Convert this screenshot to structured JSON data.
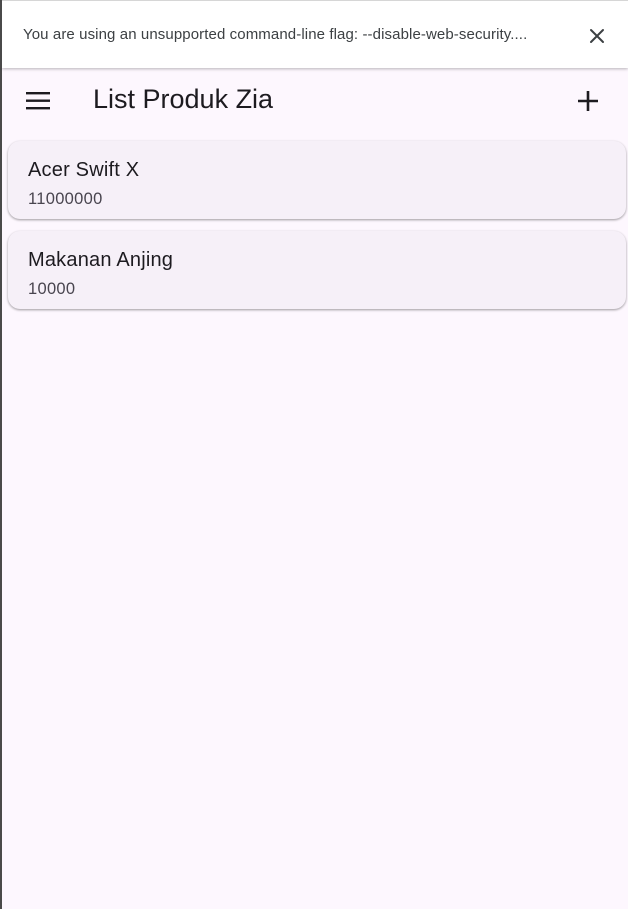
{
  "infobar": {
    "message": "You are using an unsupported command-line flag: --disable-web-security....",
    "close_icon": "close-icon"
  },
  "appbar": {
    "menu_icon": "hamburger-menu-icon",
    "title": "List Produk Zia",
    "add_icon": "plus-icon"
  },
  "products": [
    {
      "name": "Acer Swift X",
      "price": "11000000"
    },
    {
      "name": "Makanan Anjing",
      "price": "10000"
    }
  ],
  "colors": {
    "background": "#fdf7fe",
    "card": "#f6f0f8",
    "text_primary": "#1d1b20",
    "text_secondary": "#49454f"
  }
}
